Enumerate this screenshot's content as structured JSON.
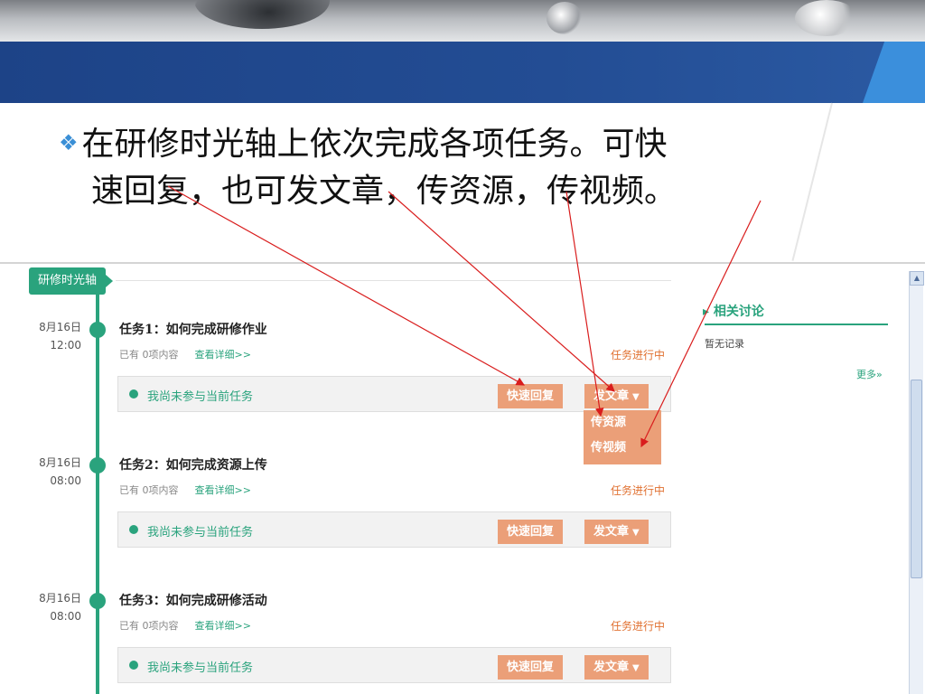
{
  "slide": {
    "line1": "在研修时光轴上依次完成各项任务。可快",
    "line2": "速回复，也可发文章，传资源，传视频。",
    "bullet_icon": "diamond-cluster-icon"
  },
  "app": {
    "timeline_tag": "研修时光轴",
    "tasks": [
      {
        "date": "8月16日",
        "time": "12:00",
        "title": "任务1：如何完成研修作业",
        "meta": "已有 0项内容",
        "link": "查看详细>>",
        "status": "任务进行中",
        "participation": "我尚未参与当前任务",
        "reply": "快速回复",
        "post": "发文章"
      },
      {
        "date": "8月16日",
        "time": "08:00",
        "title": "任务2：如何完成资源上传",
        "meta": "已有 0项内容",
        "link": "查看详细>>",
        "status": "任务进行中",
        "participation": "我尚未参与当前任务",
        "reply": "快速回复",
        "post": "发文章"
      },
      {
        "date": "8月16日",
        "time": "08:00",
        "title": "任务3：如何完成研修活动",
        "meta": "已有 0项内容",
        "link": "查看详细>>",
        "status": "任务进行中",
        "participation": "我尚未参与当前任务",
        "reply": "快速回复",
        "post": "发文章"
      }
    ],
    "dropdown": [
      "传资源",
      "传视频"
    ],
    "sidebar": {
      "title": "相关讨论",
      "empty": "暂无记录",
      "more": "更多»"
    }
  },
  "colors": {
    "accent": "#2aa37d",
    "button": "#eb9f78",
    "status": "#e07030",
    "arrow": "#d91d1d",
    "banner": "#234d94"
  }
}
